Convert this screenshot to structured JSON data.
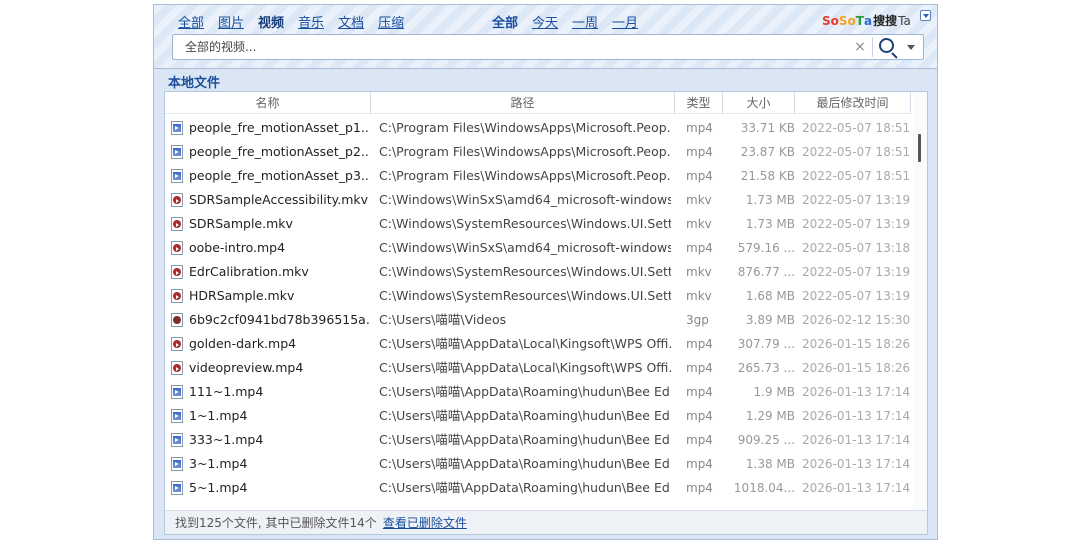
{
  "categories": [
    {
      "label": "全部",
      "active": false
    },
    {
      "label": "图片",
      "active": false
    },
    {
      "label": "视频",
      "active": true
    },
    {
      "label": "音乐",
      "active": false
    },
    {
      "label": "文档",
      "active": false
    },
    {
      "label": "压缩",
      "active": false
    }
  ],
  "times": [
    {
      "label": "全部",
      "active": true
    },
    {
      "label": "今天",
      "active": false
    },
    {
      "label": "一周",
      "active": false
    },
    {
      "label": "一月",
      "active": false
    }
  ],
  "logo": {
    "p1": "So",
    "p2": "So",
    "p3": "T",
    "p4": "a",
    "cn": "搜搜",
    "suffix": "Ta"
  },
  "search": {
    "placeholder": "全部的视频...",
    "value": "",
    "clear_glyph": "×"
  },
  "section_title": "本地文件",
  "columns": {
    "name": "名称",
    "path": "路径",
    "type": "类型",
    "size": "大小",
    "modified": "最后修改时间"
  },
  "rows": [
    {
      "name": "people_fre_motionAsset_p1....",
      "path": "C:\\Program Files\\WindowsApps\\Microsoft.Peop...",
      "type": "mp4",
      "size": "33.71 KB",
      "modified": "2022-05-07 18:51",
      "icon": "mp4"
    },
    {
      "name": "people_fre_motionAsset_p2....",
      "path": "C:\\Program Files\\WindowsApps\\Microsoft.Peop...",
      "type": "mp4",
      "size": "23.87 KB",
      "modified": "2022-05-07 18:51",
      "icon": "mp4"
    },
    {
      "name": "people_fre_motionAsset_p3....",
      "path": "C:\\Program Files\\WindowsApps\\Microsoft.Peop...",
      "type": "mp4",
      "size": "21.58 KB",
      "modified": "2022-05-07 18:51",
      "icon": "mp4"
    },
    {
      "name": "SDRSampleAccessibility.mkv",
      "path": "C:\\Windows\\WinSxS\\amd64_microsoft-windows...",
      "type": "mkv",
      "size": "1.73 MB",
      "modified": "2022-05-07 13:19",
      "icon": "mkv"
    },
    {
      "name": "SDRSample.mkv",
      "path": "C:\\Windows\\SystemResources\\Windows.UI.Setti...",
      "type": "mkv",
      "size": "1.73 MB",
      "modified": "2022-05-07 13:19",
      "icon": "mkv"
    },
    {
      "name": "oobe-intro.mp4",
      "path": "C:\\Windows\\WinSxS\\amd64_microsoft-windows...",
      "type": "mp4",
      "size": "579.16 ...",
      "modified": "2022-05-07 13:18",
      "icon": "mkv"
    },
    {
      "name": "EdrCalibration.mkv",
      "path": "C:\\Windows\\SystemResources\\Windows.UI.Setti...",
      "type": "mkv",
      "size": "876.77 ...",
      "modified": "2022-05-07 13:19",
      "icon": "mkv"
    },
    {
      "name": "HDRSample.mkv",
      "path": "C:\\Windows\\SystemResources\\Windows.UI.Setti...",
      "type": "mkv",
      "size": "1.68 MB",
      "modified": "2022-05-07 13:19",
      "icon": "mkv"
    },
    {
      "name": "6b9c2cf0941bd78b396515a...",
      "path": "C:\\Users\\喵喵\\Videos",
      "type": "3gp",
      "size": "3.89 MB",
      "modified": "2026-02-12 15:30",
      "icon": "g3p"
    },
    {
      "name": "golden-dark.mp4",
      "path": "C:\\Users\\喵喵\\AppData\\Local\\Kingsoft\\WPS Offi...",
      "type": "mp4",
      "size": "307.79 ...",
      "modified": "2026-01-15 18:26",
      "icon": "mkv"
    },
    {
      "name": "videopreview.mp4",
      "path": "C:\\Users\\喵喵\\AppData\\Local\\Kingsoft\\WPS Offi...",
      "type": "mp4",
      "size": "265.73 ...",
      "modified": "2026-01-15 18:26",
      "icon": "mkv"
    },
    {
      "name": "111~1.mp4",
      "path": "C:\\Users\\喵喵\\AppData\\Roaming\\hudun\\Bee Ed...",
      "type": "mp4",
      "size": "1.9 MB",
      "modified": "2026-01-13 17:14",
      "icon": "mp4"
    },
    {
      "name": "1~1.mp4",
      "path": "C:\\Users\\喵喵\\AppData\\Roaming\\hudun\\Bee Ed...",
      "type": "mp4",
      "size": "1.29 MB",
      "modified": "2026-01-13 17:14",
      "icon": "mp4"
    },
    {
      "name": "333~1.mp4",
      "path": "C:\\Users\\喵喵\\AppData\\Roaming\\hudun\\Bee Ed...",
      "type": "mp4",
      "size": "909.25 ...",
      "modified": "2026-01-13 17:14",
      "icon": "mp4"
    },
    {
      "name": "3~1.mp4",
      "path": "C:\\Users\\喵喵\\AppData\\Roaming\\hudun\\Bee Ed...",
      "type": "mp4",
      "size": "1.38 MB",
      "modified": "2026-01-13 17:14",
      "icon": "mp4"
    },
    {
      "name": "5~1.mp4",
      "path": "C:\\Users\\喵喵\\AppData\\Roaming\\hudun\\Bee Ed...",
      "type": "mp4",
      "size": "1018.04...",
      "modified": "2026-01-13 17:14",
      "icon": "mp4"
    }
  ],
  "status": {
    "text": "找到125个文件, 其中已删除文件14个",
    "link": "查看已删除文件"
  }
}
